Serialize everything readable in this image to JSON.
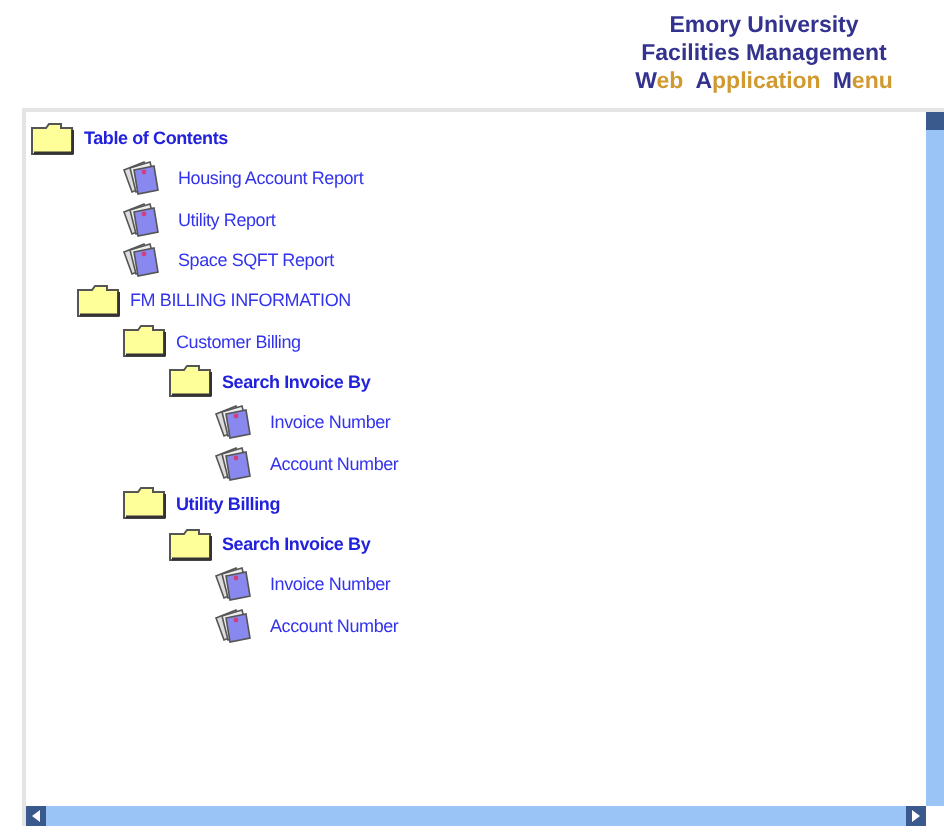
{
  "header": {
    "lines": [
      "Emory University",
      "Facilities Management"
    ],
    "menu_title": [
      "Web",
      "Application",
      "Menu"
    ]
  },
  "tree": [
    {
      "label": "Table of Contents",
      "kind": "folder",
      "bold": true,
      "children": [
        {
          "label": "Housing Account Report",
          "kind": "document",
          "bold": false
        },
        {
          "label": "Utility Report",
          "kind": "document",
          "bold": false
        },
        {
          "label": "Space SQFT Report",
          "kind": "document",
          "bold": false
        },
        {
          "label": "FM BILLING INFORMATION",
          "kind": "folder",
          "bold": false,
          "children": [
            {
              "label": "Customer Billing",
              "kind": "folder",
              "bold": false,
              "children": [
                {
                  "label": "Search Invoice By",
                  "kind": "folder",
                  "bold": true,
                  "children": [
                    {
                      "label": "Invoice Number",
                      "kind": "document",
                      "bold": false
                    },
                    {
                      "label": "Account Number",
                      "kind": "document",
                      "bold": false
                    }
                  ]
                }
              ]
            },
            {
              "label": "Utility Billing",
              "kind": "folder",
              "bold": true,
              "children": [
                {
                  "label": "Search Invoice By",
                  "kind": "folder",
                  "bold": true,
                  "children": [
                    {
                      "label": "Invoice Number",
                      "kind": "document",
                      "bold": false
                    },
                    {
                      "label": "Account Number",
                      "kind": "document",
                      "bold": false
                    }
                  ]
                }
              ]
            }
          ]
        }
      ]
    }
  ]
}
